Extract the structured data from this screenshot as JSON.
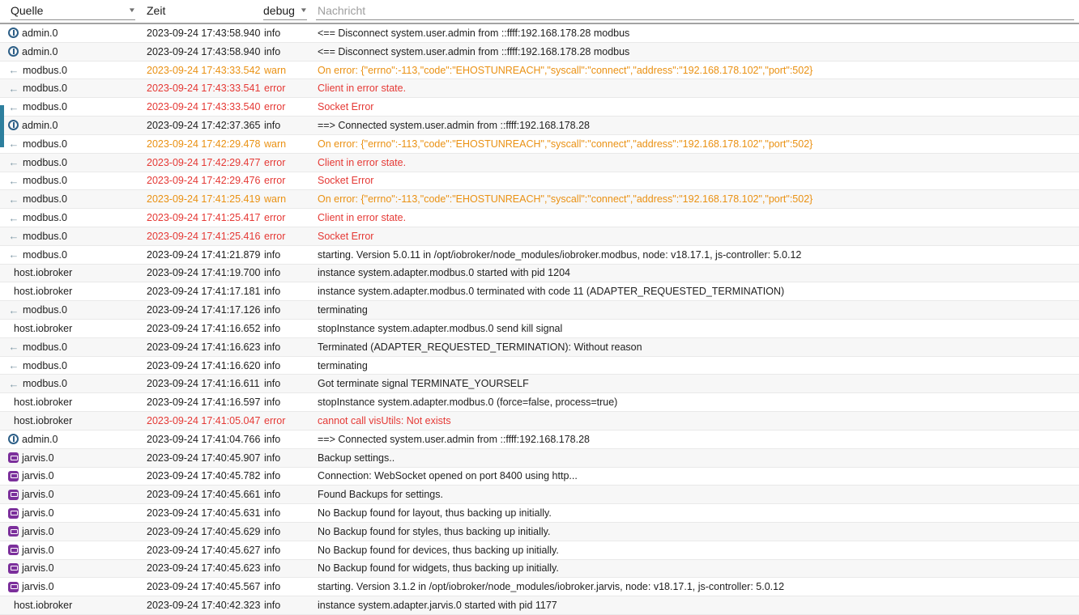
{
  "header": {
    "source_label": "Quelle",
    "time_label": "Zeit",
    "severity_value": "debug",
    "message_placeholder": "Nachricht"
  },
  "colors": {
    "info_text": "#212121",
    "warn_text": "#ea9113",
    "error_text": "#e53935",
    "accent_bar": "#2d7f9e",
    "admin_blue": "#2d5f87",
    "jarvis_purple": "#7b2f9b",
    "placeholder_gray": "#9e9e9e"
  },
  "rows": [
    {
      "source": "admin.0",
      "icon": "admin",
      "time": "2023-09-24 17:43:58.940",
      "severity": "info",
      "level": "info",
      "message": "<== Disconnect system.user.admin from ::ffff:192.168.178.28 modbus"
    },
    {
      "source": "admin.0",
      "icon": "admin",
      "time": "2023-09-24 17:43:58.940",
      "severity": "info",
      "level": "info",
      "message": "<== Disconnect system.user.admin from ::ffff:192.168.178.28 modbus"
    },
    {
      "source": "modbus.0",
      "icon": "modbus",
      "time": "2023-09-24 17:43:33.542",
      "severity": "warn",
      "level": "warn",
      "message": "On error: {\"errno\":-113,\"code\":\"EHOSTUNREACH\",\"syscall\":\"connect\",\"address\":\"192.168.178.102\",\"port\":502}"
    },
    {
      "source": "modbus.0",
      "icon": "modbus",
      "time": "2023-09-24 17:43:33.541",
      "severity": "error",
      "level": "error",
      "message": "Client in error state."
    },
    {
      "source": "modbus.0",
      "icon": "modbus",
      "time": "2023-09-24 17:43:33.540",
      "severity": "error",
      "level": "error",
      "message": "Socket Error"
    },
    {
      "source": "admin.0",
      "icon": "admin",
      "time": "2023-09-24 17:42:37.365",
      "severity": "info",
      "level": "info",
      "message": "==> Connected system.user.admin from ::ffff:192.168.178.28"
    },
    {
      "source": "modbus.0",
      "icon": "modbus",
      "time": "2023-09-24 17:42:29.478",
      "severity": "warn",
      "level": "warn",
      "message": "On error: {\"errno\":-113,\"code\":\"EHOSTUNREACH\",\"syscall\":\"connect\",\"address\":\"192.168.178.102\",\"port\":502}"
    },
    {
      "source": "modbus.0",
      "icon": "modbus",
      "time": "2023-09-24 17:42:29.477",
      "severity": "error",
      "level": "error",
      "message": "Client in error state."
    },
    {
      "source": "modbus.0",
      "icon": "modbus",
      "time": "2023-09-24 17:42:29.476",
      "severity": "error",
      "level": "error",
      "message": "Socket Error"
    },
    {
      "source": "modbus.0",
      "icon": "modbus",
      "time": "2023-09-24 17:41:25.419",
      "severity": "warn",
      "level": "warn",
      "message": "On error: {\"errno\":-113,\"code\":\"EHOSTUNREACH\",\"syscall\":\"connect\",\"address\":\"192.168.178.102\",\"port\":502}"
    },
    {
      "source": "modbus.0",
      "icon": "modbus",
      "time": "2023-09-24 17:41:25.417",
      "severity": "error",
      "level": "error",
      "message": "Client in error state."
    },
    {
      "source": "modbus.0",
      "icon": "modbus",
      "time": "2023-09-24 17:41:25.416",
      "severity": "error",
      "level": "error",
      "message": "Socket Error"
    },
    {
      "source": "modbus.0",
      "icon": "modbus",
      "time": "2023-09-24 17:41:21.879",
      "severity": "info",
      "level": "info",
      "message": "starting. Version 5.0.11 in /opt/iobroker/node_modules/iobroker.modbus, node: v18.17.1, js-controller: 5.0.12"
    },
    {
      "source": "host.iobroker",
      "icon": null,
      "time": "2023-09-24 17:41:19.700",
      "severity": "info",
      "level": "info",
      "message": "instance system.adapter.modbus.0 started with pid 1204"
    },
    {
      "source": "host.iobroker",
      "icon": null,
      "time": "2023-09-24 17:41:17.181",
      "severity": "info",
      "level": "info",
      "message": "instance system.adapter.modbus.0 terminated with code 11 (ADAPTER_REQUESTED_TERMINATION)"
    },
    {
      "source": "modbus.0",
      "icon": "modbus",
      "time": "2023-09-24 17:41:17.126",
      "severity": "info",
      "level": "info",
      "message": "terminating"
    },
    {
      "source": "host.iobroker",
      "icon": null,
      "time": "2023-09-24 17:41:16.652",
      "severity": "info",
      "level": "info",
      "message": "stopInstance system.adapter.modbus.0 send kill signal"
    },
    {
      "source": "modbus.0",
      "icon": "modbus",
      "time": "2023-09-24 17:41:16.623",
      "severity": "info",
      "level": "info",
      "message": "Terminated (ADAPTER_REQUESTED_TERMINATION): Without reason"
    },
    {
      "source": "modbus.0",
      "icon": "modbus",
      "time": "2023-09-24 17:41:16.620",
      "severity": "info",
      "level": "info",
      "message": "terminating"
    },
    {
      "source": "modbus.0",
      "icon": "modbus",
      "time": "2023-09-24 17:41:16.611",
      "severity": "info",
      "level": "info",
      "message": "Got terminate signal TERMINATE_YOURSELF"
    },
    {
      "source": "host.iobroker",
      "icon": null,
      "time": "2023-09-24 17:41:16.597",
      "severity": "info",
      "level": "info",
      "message": "stopInstance system.adapter.modbus.0 (force=false, process=true)"
    },
    {
      "source": "host.iobroker",
      "icon": null,
      "time": "2023-09-24 17:41:05.047",
      "severity": "error",
      "level": "error",
      "message": "cannot call visUtils: Not exists"
    },
    {
      "source": "admin.0",
      "icon": "admin",
      "time": "2023-09-24 17:41:04.766",
      "severity": "info",
      "level": "info",
      "message": "==> Connected system.user.admin from ::ffff:192.168.178.28"
    },
    {
      "source": "jarvis.0",
      "icon": "jarvis",
      "time": "2023-09-24 17:40:45.907",
      "severity": "info",
      "level": "info",
      "message": "Backup settings.."
    },
    {
      "source": "jarvis.0",
      "icon": "jarvis",
      "time": "2023-09-24 17:40:45.782",
      "severity": "info",
      "level": "info",
      "message": "Connection: WebSocket opened on port 8400 using http..."
    },
    {
      "source": "jarvis.0",
      "icon": "jarvis",
      "time": "2023-09-24 17:40:45.661",
      "severity": "info",
      "level": "info",
      "message": "Found Backups for settings."
    },
    {
      "source": "jarvis.0",
      "icon": "jarvis",
      "time": "2023-09-24 17:40:45.631",
      "severity": "info",
      "level": "info",
      "message": "No Backup found for layout, thus backing up initially."
    },
    {
      "source": "jarvis.0",
      "icon": "jarvis",
      "time": "2023-09-24 17:40:45.629",
      "severity": "info",
      "level": "info",
      "message": "No Backup found for styles, thus backing up initially."
    },
    {
      "source": "jarvis.0",
      "icon": "jarvis",
      "time": "2023-09-24 17:40:45.627",
      "severity": "info",
      "level": "info",
      "message": "No Backup found for devices, thus backing up initially."
    },
    {
      "source": "jarvis.0",
      "icon": "jarvis",
      "time": "2023-09-24 17:40:45.623",
      "severity": "info",
      "level": "info",
      "message": "No Backup found for widgets, thus backing up initially."
    },
    {
      "source": "jarvis.0",
      "icon": "jarvis",
      "time": "2023-09-24 17:40:45.567",
      "severity": "info",
      "level": "info",
      "message": "starting. Version 3.1.2 in /opt/iobroker/node_modules/iobroker.jarvis, node: v18.17.1, js-controller: 5.0.12"
    },
    {
      "source": "host.iobroker",
      "icon": null,
      "time": "2023-09-24 17:40:42.323",
      "severity": "info",
      "level": "info",
      "message": "instance system.adapter.jarvis.0 started with pid 1177"
    }
  ]
}
